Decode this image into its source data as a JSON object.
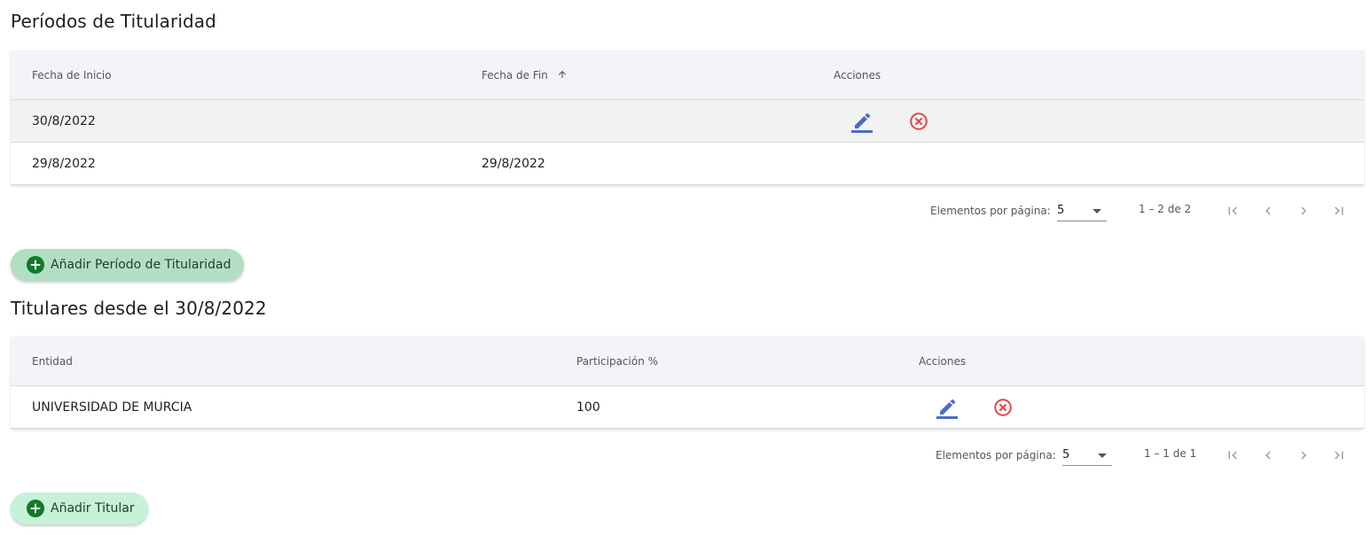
{
  "periods": {
    "title": "Períodos de Titularidad",
    "columns": {
      "start": "Fecha de Inicio",
      "end": "Fecha de Fin",
      "actions": "Acciones"
    },
    "rows": [
      {
        "start": "30/8/2022",
        "end": ""
      },
      {
        "start": "29/8/2022",
        "end": "29/8/2022"
      }
    ],
    "paginator": {
      "items_label": "Elementos por página:",
      "page_size": "5",
      "range": "1 – 2 de 2"
    },
    "add_button": "Añadir Período de Titularidad"
  },
  "holders": {
    "title": "Titulares desde el 30/8/2022",
    "columns": {
      "entity": "Entidad",
      "share": "Participación %",
      "actions": "Acciones"
    },
    "rows": [
      {
        "entity": "UNIVERSIDAD DE MURCIA",
        "share": "100"
      }
    ],
    "paginator": {
      "items_label": "Elementos por página:",
      "page_size": "5",
      "range": "1 – 1 de 1"
    },
    "add_button": "Añadir Titular"
  },
  "icons": {
    "edit": "pencil-icon",
    "delete": "cancel-circle-icon",
    "sort": "arrow-up-icon",
    "first": "first-page-icon",
    "prev": "chevron-left-icon",
    "next": "chevron-right-icon",
    "last": "last-page-icon",
    "add": "add-circle-icon"
  },
  "colors": {
    "edit": "#4a6cc7",
    "delete": "#e04848",
    "add_primary_bg": "#b2dfc3",
    "add_secondary_bg": "#c6f2d7",
    "add_icon": "#0f7a2a",
    "header_bg": "#f2f4f7"
  }
}
